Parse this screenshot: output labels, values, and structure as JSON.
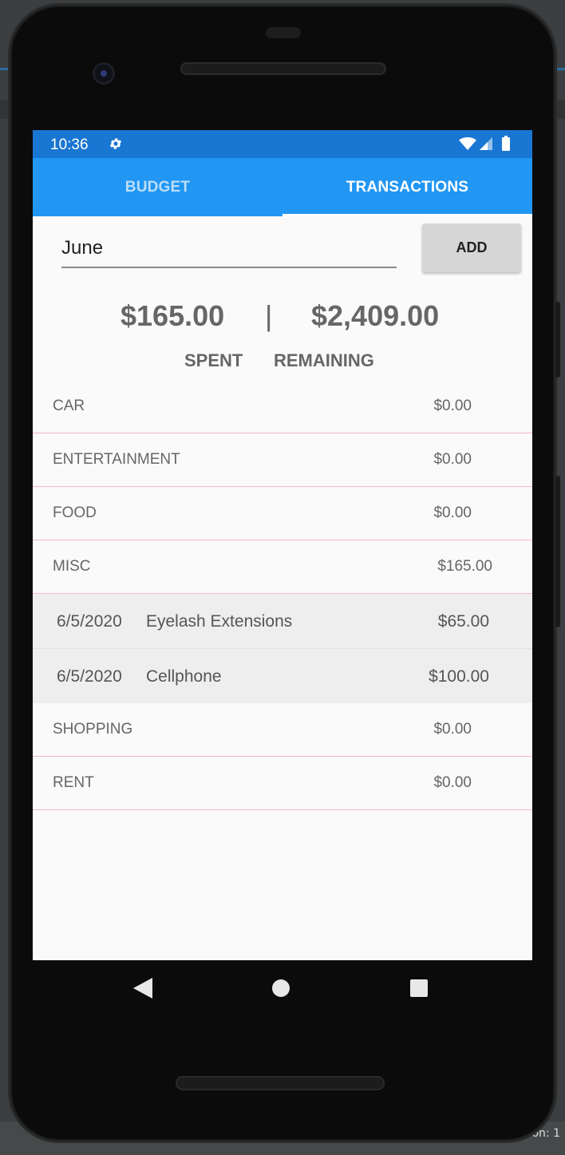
{
  "ide": {
    "bottom_text": "on: 1"
  },
  "status": {
    "time": "10:36"
  },
  "tabs": [
    {
      "label": "BUDGET"
    },
    {
      "label": "TRANSACTIONS"
    }
  ],
  "month_input": {
    "value": "June"
  },
  "add_button": {
    "label": "ADD"
  },
  "summary": {
    "spent_amount": "$165.00",
    "divider": "|",
    "remaining_amount": "$2,409.00",
    "spent_label": "SPENT",
    "remaining_label": "REMAINING"
  },
  "categories": [
    {
      "name": "CAR",
      "amount": "$0.00"
    },
    {
      "name": "ENTERTAINMENT",
      "amount": "$0.00"
    },
    {
      "name": "FOOD",
      "amount": "$0.00"
    },
    {
      "name": "MISC",
      "amount": "$165.00"
    },
    {
      "name": "SHOPPING",
      "amount": "$0.00"
    },
    {
      "name": "RENT",
      "amount": "$0.00"
    }
  ],
  "transactions": [
    {
      "date": "6/5/2020",
      "description": "Eyelash Extensions",
      "amount": "$65.00"
    },
    {
      "date": "6/5/2020",
      "description": "Cellphone",
      "amount": "$100.00"
    }
  ],
  "colors": {
    "status_bar": "#1976d2",
    "tab_bar": "#2196f3",
    "row_divider": "#f4b8c6",
    "transaction_bg": "#eeeeee"
  },
  "icons": {
    "status": [
      "gear-icon",
      "wifi-icon",
      "signal-icon",
      "battery-icon"
    ],
    "nav": [
      "back-icon",
      "home-icon",
      "recents-icon"
    ]
  }
}
